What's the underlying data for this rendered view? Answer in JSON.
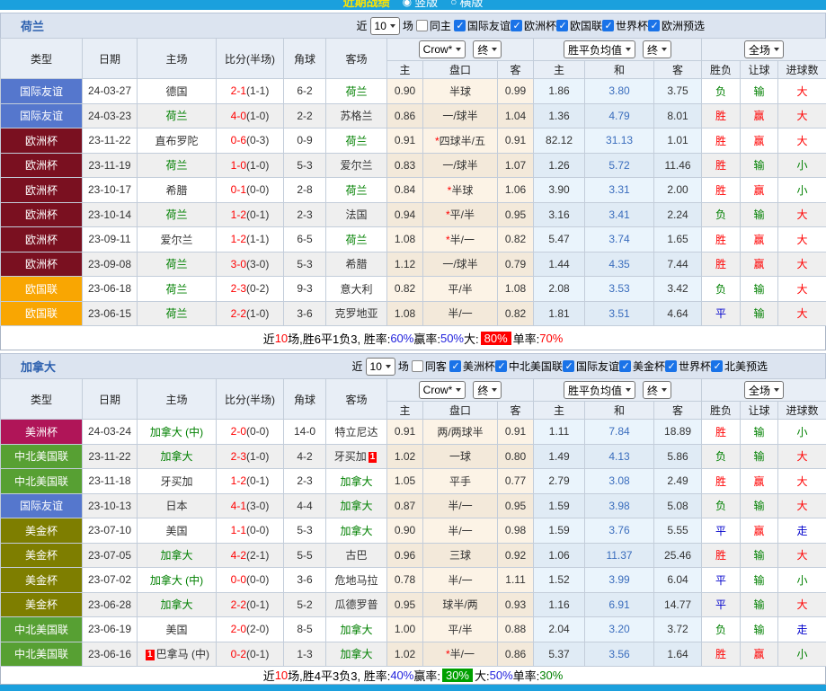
{
  "top_bar": {
    "title": "近期战绩",
    "options": [
      {
        "label": "竖版",
        "selected": true
      },
      {
        "label": "横版",
        "selected": false
      }
    ]
  },
  "palette": {
    "red": "#ff0000",
    "blue": "#2222dd",
    "green": "#008000",
    "badge_red": "#ff0000",
    "badge_green": "#00a000"
  },
  "type_colors": {
    "国际友谊": "#5577cd",
    "欧洲杯": "#7a1020",
    "欧国联": "#f9a602",
    "美洲杯": "#b01558",
    "中北美国联": "#57a033",
    "美金杯": "#7e7e00"
  },
  "result_colors": {
    "胜": "#ff0000",
    "负": "#008000",
    "平": "#0000cc",
    "赢": "#ff0000",
    "输": "#008000",
    "大": "#ff0000",
    "小": "#008000",
    "走": "#0000cc"
  },
  "sections": [
    {
      "team": "荷兰",
      "filter": {
        "near": "近",
        "games": "10",
        "games_suffix": "场",
        "same": {
          "label": "同主",
          "checked": false
        },
        "competitions": [
          {
            "label": "国际友谊",
            "checked": true
          },
          {
            "label": "欧洲杯",
            "checked": true
          },
          {
            "label": "欧国联",
            "checked": true
          },
          {
            "label": "世界杯",
            "checked": true
          },
          {
            "label": "欧洲预选",
            "checked": true
          }
        ]
      },
      "selects": {
        "bookmaker": "Crow*",
        "final1": "终",
        "europe": "胜平负均值",
        "final2": "终",
        "scope": "全场"
      },
      "columns": {
        "type": "类型",
        "date": "日期",
        "home": "主场",
        "score": "比分(半场)",
        "corner": "角球",
        "away": "客场",
        "sub": [
          "主",
          "盘口",
          "客",
          "主",
          "和",
          "客",
          "胜负",
          "让球",
          "进球数"
        ]
      },
      "rows": [
        {
          "type": "国际友谊",
          "date": "24-03-27",
          "home": "德国",
          "home_green": false,
          "home_badge": "",
          "score_ft": "2-1",
          "score_ht": "(1-1)",
          "corner": "6-2",
          "away": "荷兰",
          "away_green": true,
          "away_badge": "",
          "h1": "0.90",
          "star": "",
          "handicap": "半球",
          "h2": "0.99",
          "eu_h": "1.86",
          "eu_d": "3.80",
          "eu_a": "3.75",
          "res_wdl": "负",
          "res_let": "输",
          "res_goals": "大"
        },
        {
          "type": "国际友谊",
          "date": "24-03-23",
          "home": "荷兰",
          "home_green": true,
          "home_badge": "",
          "score_ft": "4-0",
          "score_ht": "(1-0)",
          "corner": "2-2",
          "away": "苏格兰",
          "away_green": false,
          "away_badge": "",
          "h1": "0.86",
          "star": "",
          "handicap": "一/球半",
          "h2": "1.04",
          "eu_h": "1.36",
          "eu_d": "4.79",
          "eu_a": "8.01",
          "res_wdl": "胜",
          "res_let": "赢",
          "res_goals": "大"
        },
        {
          "type": "欧洲杯",
          "date": "23-11-22",
          "home": "直布罗陀",
          "home_green": false,
          "home_badge": "",
          "score_ft": "0-6",
          "score_ht": "(0-3)",
          "corner": "0-9",
          "away": "荷兰",
          "away_green": true,
          "away_badge": "",
          "h1": "0.91",
          "star": "*",
          "handicap": "四球半/五",
          "h2": "0.91",
          "eu_h": "82.12",
          "eu_d": "31.13",
          "eu_a": "1.01",
          "res_wdl": "胜",
          "res_let": "赢",
          "res_goals": "大"
        },
        {
          "type": "欧洲杯",
          "date": "23-11-19",
          "home": "荷兰",
          "home_green": true,
          "home_badge": "",
          "score_ft": "1-0",
          "score_ht": "(1-0)",
          "corner": "5-3",
          "away": "爱尔兰",
          "away_green": false,
          "away_badge": "",
          "h1": "0.83",
          "star": "",
          "handicap": "一/球半",
          "h2": "1.07",
          "eu_h": "1.26",
          "eu_d": "5.72",
          "eu_a": "11.46",
          "res_wdl": "胜",
          "res_let": "输",
          "res_goals": "小"
        },
        {
          "type": "欧洲杯",
          "date": "23-10-17",
          "home": "希腊",
          "home_green": false,
          "home_badge": "",
          "score_ft": "0-1",
          "score_ht": "(0-0)",
          "corner": "2-8",
          "away": "荷兰",
          "away_green": true,
          "away_badge": "",
          "h1": "0.84",
          "star": "*",
          "handicap": "半球",
          "h2": "1.06",
          "eu_h": "3.90",
          "eu_d": "3.31",
          "eu_a": "2.00",
          "res_wdl": "胜",
          "res_let": "赢",
          "res_goals": "小"
        },
        {
          "type": "欧洲杯",
          "date": "23-10-14",
          "home": "荷兰",
          "home_green": true,
          "home_badge": "",
          "score_ft": "1-2",
          "score_ht": "(0-1)",
          "corner": "2-3",
          "away": "法国",
          "away_green": false,
          "away_badge": "",
          "h1": "0.94",
          "star": "*",
          "handicap": "平/半",
          "h2": "0.95",
          "eu_h": "3.16",
          "eu_d": "3.41",
          "eu_a": "2.24",
          "res_wdl": "负",
          "res_let": "输",
          "res_goals": "大"
        },
        {
          "type": "欧洲杯",
          "date": "23-09-11",
          "home": "爱尔兰",
          "home_green": false,
          "home_badge": "",
          "score_ft": "1-2",
          "score_ht": "(1-1)",
          "corner": "6-5",
          "away": "荷兰",
          "away_green": true,
          "away_badge": "",
          "h1": "1.08",
          "star": "*",
          "handicap": "半/一",
          "h2": "0.82",
          "eu_h": "5.47",
          "eu_d": "3.74",
          "eu_a": "1.65",
          "res_wdl": "胜",
          "res_let": "赢",
          "res_goals": "大"
        },
        {
          "type": "欧洲杯",
          "date": "23-09-08",
          "home": "荷兰",
          "home_green": true,
          "home_badge": "",
          "score_ft": "3-0",
          "score_ht": "(3-0)",
          "corner": "5-3",
          "away": "希腊",
          "away_green": false,
          "away_badge": "",
          "h1": "1.12",
          "star": "",
          "handicap": "一/球半",
          "h2": "0.79",
          "eu_h": "1.44",
          "eu_d": "4.35",
          "eu_a": "7.44",
          "res_wdl": "胜",
          "res_let": "赢",
          "res_goals": "大"
        },
        {
          "type": "欧国联",
          "date": "23-06-18",
          "home": "荷兰",
          "home_green": true,
          "home_badge": "",
          "score_ft": "2-3",
          "score_ht": "(0-2)",
          "corner": "9-3",
          "away": "意大利",
          "away_green": false,
          "away_badge": "",
          "h1": "0.82",
          "star": "",
          "handicap": "平/半",
          "h2": "1.08",
          "eu_h": "2.08",
          "eu_d": "3.53",
          "eu_a": "3.42",
          "res_wdl": "负",
          "res_let": "输",
          "res_goals": "大"
        },
        {
          "type": "欧国联",
          "date": "23-06-15",
          "home": "荷兰",
          "home_green": true,
          "home_badge": "",
          "score_ft": "2-2",
          "score_ht": "(1-0)",
          "corner": "3-6",
          "away": "克罗地亚",
          "away_green": false,
          "away_badge": "",
          "h1": "1.08",
          "star": "",
          "handicap": "半/一",
          "h2": "0.82",
          "eu_h": "1.81",
          "eu_d": "3.51",
          "eu_a": "4.64",
          "res_wdl": "平",
          "res_let": "输",
          "res_goals": "大"
        }
      ],
      "summary": [
        {
          "text": "近"
        },
        {
          "text": "10",
          "color": "red"
        },
        {
          "text": "场,胜6平1负3, 胜率:"
        },
        {
          "text": "60%",
          "color": "blue"
        },
        {
          "text": " 赢率:"
        },
        {
          "text": "50%",
          "color": "blue"
        },
        {
          "text": " 大:"
        },
        {
          "text": "80%",
          "badge": "badge_red"
        },
        {
          "text": " 单率:"
        },
        {
          "text": "70%",
          "color": "red"
        }
      ]
    },
    {
      "team": "加拿大",
      "filter": {
        "near": "近",
        "games": "10",
        "games_suffix": "场",
        "same": {
          "label": "同客",
          "checked": false
        },
        "competitions": [
          {
            "label": "美洲杯",
            "checked": true
          },
          {
            "label": "中北美国联",
            "checked": true
          },
          {
            "label": "国际友谊",
            "checked": true
          },
          {
            "label": "美金杯",
            "checked": true
          },
          {
            "label": "世界杯",
            "checked": true
          },
          {
            "label": "北美预选",
            "checked": true
          }
        ]
      },
      "selects": {
        "bookmaker": "Crow*",
        "final1": "终",
        "europe": "胜平负均值",
        "final2": "终",
        "scope": "全场"
      },
      "columns": {
        "type": "类型",
        "date": "日期",
        "home": "主场",
        "score": "比分(半场)",
        "corner": "角球",
        "away": "客场",
        "sub": [
          "主",
          "盘口",
          "客",
          "主",
          "和",
          "客",
          "胜负",
          "让球",
          "进球数"
        ]
      },
      "rows": [
        {
          "type": "美洲杯",
          "date": "24-03-24",
          "home": "加拿大 (中)",
          "home_green": true,
          "home_badge": "",
          "score_ft": "2-0",
          "score_ht": "(0-0)",
          "corner": "14-0",
          "away": "特立尼达",
          "away_green": false,
          "away_badge": "",
          "h1": "0.91",
          "star": "",
          "handicap": "两/两球半",
          "h2": "0.91",
          "eu_h": "1.11",
          "eu_d": "7.84",
          "eu_a": "18.89",
          "res_wdl": "胜",
          "res_let": "输",
          "res_goals": "小"
        },
        {
          "type": "中北美国联",
          "date": "23-11-22",
          "home": "加拿大",
          "home_green": true,
          "home_badge": "",
          "score_ft": "2-3",
          "score_ht": "(1-0)",
          "corner": "4-2",
          "away": "牙买加",
          "away_green": false,
          "away_badge": "1",
          "h1": "1.02",
          "star": "",
          "handicap": "一球",
          "h2": "0.80",
          "eu_h": "1.49",
          "eu_d": "4.13",
          "eu_a": "5.86",
          "res_wdl": "负",
          "res_let": "输",
          "res_goals": "大"
        },
        {
          "type": "中北美国联",
          "date": "23-11-18",
          "home": "牙买加",
          "home_green": false,
          "home_badge": "",
          "score_ft": "1-2",
          "score_ht": "(0-1)",
          "corner": "2-3",
          "away": "加拿大",
          "away_green": true,
          "away_badge": "",
          "h1": "1.05",
          "star": "",
          "handicap": "平手",
          "h2": "0.77",
          "eu_h": "2.79",
          "eu_d": "3.08",
          "eu_a": "2.49",
          "res_wdl": "胜",
          "res_let": "赢",
          "res_goals": "大"
        },
        {
          "type": "国际友谊",
          "date": "23-10-13",
          "home": "日本",
          "home_green": false,
          "home_badge": "",
          "score_ft": "4-1",
          "score_ht": "(3-0)",
          "corner": "4-4",
          "away": "加拿大",
          "away_green": true,
          "away_badge": "",
          "h1": "0.87",
          "star": "",
          "handicap": "半/一",
          "h2": "0.95",
          "eu_h": "1.59",
          "eu_d": "3.98",
          "eu_a": "5.08",
          "res_wdl": "负",
          "res_let": "输",
          "res_goals": "大"
        },
        {
          "type": "美金杯",
          "date": "23-07-10",
          "home": "美国",
          "home_green": false,
          "home_badge": "",
          "score_ft": "1-1",
          "score_ht": "(0-0)",
          "corner": "5-3",
          "away": "加拿大",
          "away_green": true,
          "away_badge": "",
          "h1": "0.90",
          "star": "",
          "handicap": "半/一",
          "h2": "0.98",
          "eu_h": "1.59",
          "eu_d": "3.76",
          "eu_a": "5.55",
          "res_wdl": "平",
          "res_let": "赢",
          "res_goals": "走"
        },
        {
          "type": "美金杯",
          "date": "23-07-05",
          "home": "加拿大",
          "home_green": true,
          "home_badge": "",
          "score_ft": "4-2",
          "score_ht": "(2-1)",
          "corner": "5-5",
          "away": "古巴",
          "away_green": false,
          "away_badge": "",
          "h1": "0.96",
          "star": "",
          "handicap": "三球",
          "h2": "0.92",
          "eu_h": "1.06",
          "eu_d": "11.37",
          "eu_a": "25.46",
          "res_wdl": "胜",
          "res_let": "输",
          "res_goals": "大"
        },
        {
          "type": "美金杯",
          "date": "23-07-02",
          "home": "加拿大 (中)",
          "home_green": true,
          "home_badge": "",
          "score_ft": "0-0",
          "score_ht": "(0-0)",
          "corner": "3-6",
          "away": "危地马拉",
          "away_green": false,
          "away_badge": "",
          "h1": "0.78",
          "star": "",
          "handicap": "半/一",
          "h2": "1.11",
          "eu_h": "1.52",
          "eu_d": "3.99",
          "eu_a": "6.04",
          "res_wdl": "平",
          "res_let": "输",
          "res_goals": "小"
        },
        {
          "type": "美金杯",
          "date": "23-06-28",
          "home": "加拿大",
          "home_green": true,
          "home_badge": "",
          "score_ft": "2-2",
          "score_ht": "(0-1)",
          "corner": "5-2",
          "away": "瓜德罗普",
          "away_green": false,
          "away_badge": "",
          "h1": "0.95",
          "star": "",
          "handicap": "球半/两",
          "h2": "0.93",
          "eu_h": "1.16",
          "eu_d": "6.91",
          "eu_a": "14.77",
          "res_wdl": "平",
          "res_let": "输",
          "res_goals": "大"
        },
        {
          "type": "中北美国联",
          "date": "23-06-19",
          "home": "美国",
          "home_green": false,
          "home_badge": "",
          "score_ft": "2-0",
          "score_ht": "(2-0)",
          "corner": "8-5",
          "away": "加拿大",
          "away_green": true,
          "away_badge": "",
          "h1": "1.00",
          "star": "",
          "handicap": "平/半",
          "h2": "0.88",
          "eu_h": "2.04",
          "eu_d": "3.20",
          "eu_a": "3.72",
          "res_wdl": "负",
          "res_let": "输",
          "res_goals": "走"
        },
        {
          "type": "中北美国联",
          "date": "23-06-16",
          "home": "巴拿马 (中)",
          "home_green": false,
          "home_badge": "1",
          "score_ft": "0-2",
          "score_ht": "(0-1)",
          "corner": "1-3",
          "away": "加拿大",
          "away_green": true,
          "away_badge": "",
          "h1": "1.02",
          "star": "*",
          "handicap": "半/一",
          "h2": "0.86",
          "eu_h": "5.37",
          "eu_d": "3.56",
          "eu_a": "1.64",
          "res_wdl": "胜",
          "res_let": "赢",
          "res_goals": "小"
        }
      ],
      "summary": [
        {
          "text": "近"
        },
        {
          "text": "10",
          "color": "red"
        },
        {
          "text": "场,胜4平3负3, 胜率:"
        },
        {
          "text": "40%",
          "color": "blue"
        },
        {
          "text": " 赢率:"
        },
        {
          "text": "30%",
          "badge": "badge_green"
        },
        {
          "text": " 大:"
        },
        {
          "text": "50%",
          "color": "blue"
        },
        {
          "text": " 单率:"
        },
        {
          "text": "30%",
          "color": "green"
        }
      ]
    }
  ]
}
